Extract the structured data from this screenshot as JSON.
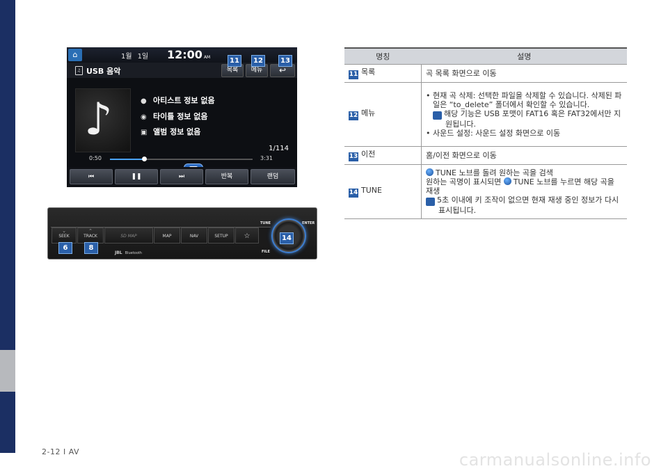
{
  "screen": {
    "date_month": "1월",
    "date_day": "1일",
    "time": "12:00",
    "ampm": "AM",
    "source_title": "USB 음악",
    "btn_list": "목록",
    "btn_menu": "메뉴",
    "artist": "아티스트 정보 없음",
    "title": "타이틀 정보 없음",
    "album": "앨범 정보 없음",
    "track_count": "1/114",
    "time_current": "0:50",
    "time_total": "3:31",
    "progress": 0.24,
    "btn_repeat": "반복",
    "btn_random": "랜덤",
    "badges": [
      "11",
      "12",
      "13"
    ]
  },
  "panel": {
    "seek": "SEEK",
    "track": "TRACK",
    "sd_map": "SD MAP",
    "map": "MAP",
    "nav": "NAV",
    "setup": "SETUP",
    "tune": "TUNE",
    "enter": "ENTER",
    "file": "FILE",
    "jbl": "JBL",
    "bluetooth": "Bluetooth",
    "badges": [
      "6",
      "8",
      "14"
    ]
  },
  "table": {
    "header_name": "명칭",
    "header_desc": "설명",
    "rows": [
      {
        "num": "11",
        "name": "목록",
        "desc": "곡 목록 화면으로 이동"
      },
      {
        "num": "12",
        "name": "메뉴",
        "bullet1": "현재 곡 삭제: 선택한 파일을 삭제할 수 있습니다. 삭제된 파일은 “to_delete” 폴더에서 확인할 수 있습니다.",
        "note": "해당 기능은 USB 포맷이 FAT16 혹은 FAT32에서만 지원됩니다.",
        "bullet2": "사운드 설정: 사운드 설정 화면으로 이동"
      },
      {
        "num": "13",
        "name": "이전",
        "desc": "홈/이전 화면으로 이동"
      },
      {
        "num": "14",
        "name": "TUNE",
        "line1_word": "TUNE",
        "line1_rest": "노브를 돌려 원하는 곡을 검색",
        "line2_pre": "원하는 곡명이 표시되면",
        "line2_word": "TUNE",
        "line2_rest": "노브를 누르면 해당 곡을 재생",
        "note": "5초 이내에 키 조작이 없으면 현재 재생 중인 정보가 다시 표시됩니다."
      }
    ]
  },
  "info_icon": "i",
  "page_number": "2-12 I AV",
  "watermark": "carmanualsonline.info"
}
